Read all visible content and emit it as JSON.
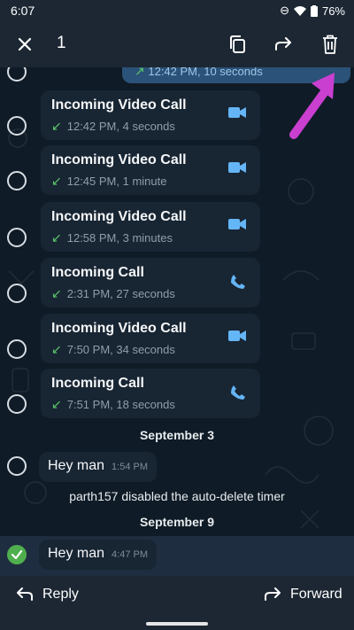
{
  "status": {
    "time": "6:07",
    "battery": "76%"
  },
  "toolbar": {
    "selected_count": "1"
  },
  "partial_top": {
    "text": "12:42 PM, 10 seconds"
  },
  "calls": [
    {
      "title": "Incoming Video Call",
      "meta": "12:42 PM, 4 seconds",
      "icon": "video-call-icon"
    },
    {
      "title": "Incoming Video Call",
      "meta": "12:45 PM, 1 minute",
      "icon": "video-call-icon"
    },
    {
      "title": "Incoming Video Call",
      "meta": "12:58 PM, 3 minutes",
      "icon": "video-call-icon"
    },
    {
      "title": "Incoming Call",
      "meta": "2:31 PM, 27 seconds",
      "icon": "phone-icon"
    },
    {
      "title": "Incoming Video Call",
      "meta": "7:50 PM, 34 seconds",
      "icon": "video-call-icon"
    },
    {
      "title": "Incoming Call",
      "meta": "7:51 PM, 18 seconds",
      "icon": "phone-icon"
    }
  ],
  "date1": "September 3",
  "msg1": {
    "text": "Hey man",
    "time": "1:54 PM"
  },
  "service": "parth157 disabled the auto-delete timer",
  "date2": "September 9",
  "msg2": {
    "text": "Hey man",
    "time": "4:47 PM"
  },
  "bottom": {
    "reply": "Reply",
    "forward": "Forward"
  },
  "colors": {
    "accent": "#64b5f6",
    "incoming_arrow": "#5cc76a",
    "selected_check": "#4fae4e",
    "annotation_arrow": "#c93fd0"
  }
}
